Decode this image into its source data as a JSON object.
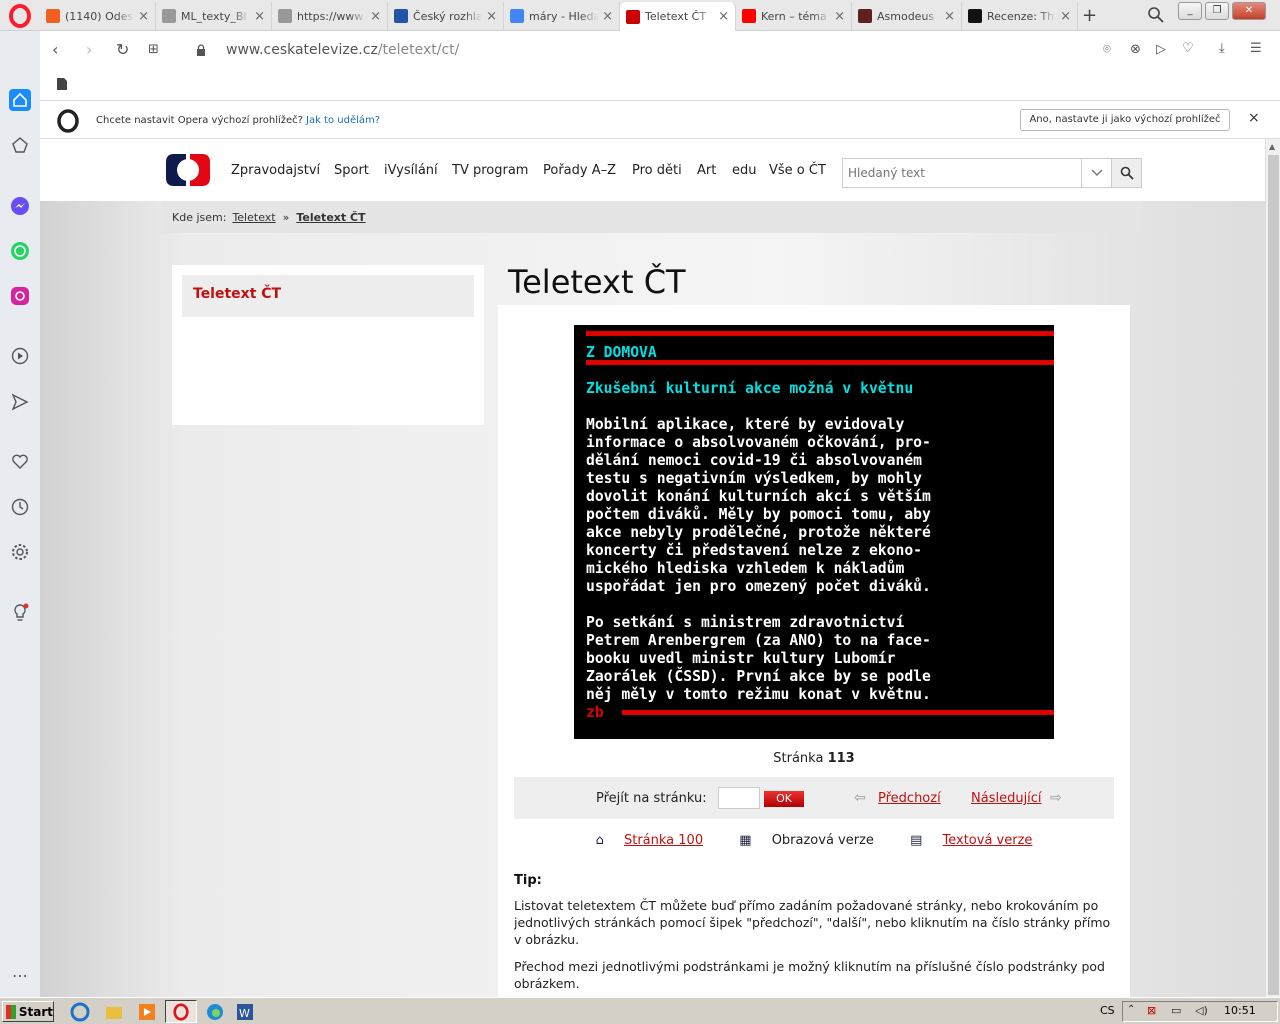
{
  "browser": {
    "tabs": [
      {
        "title": "(1140) Odes",
        "fav": "#f06020"
      },
      {
        "title": "ML_texty_Bl",
        "fav": "#999"
      },
      {
        "title": "https://www",
        "fav": "#999"
      },
      {
        "title": "Český rozhla",
        "fav": "#2255aa"
      },
      {
        "title": "máry - Hleda",
        "fav": "#4285f4"
      },
      {
        "title": "Teletext ČT",
        "fav": "#cc0000",
        "active": true
      },
      {
        "title": "Kern – téma",
        "fav": "#ff0000"
      },
      {
        "title": "Asmodeus -",
        "fav": "#602020"
      },
      {
        "title": "Recenze: Th",
        "fav": "#111"
      }
    ],
    "url_domain": "www.ceskatelevize.cz",
    "url_path": "/teletext/ct/"
  },
  "notification": {
    "text": "Chcete nastavit Opera výchozí prohlížeč?",
    "link": "Jak to udělám?",
    "button": "Ano, nastavte ji jako výchozí prohlížeč"
  },
  "site": {
    "nav": [
      "Zpravodajství",
      "Sport",
      "iVysílání",
      "TV program",
      "Pořady A–Z",
      "Pro děti",
      "Art",
      "edu",
      "Vše o ČT"
    ],
    "search_placeholder": "Hledaný text",
    "breadcrumb": {
      "label": "Kde jsem:",
      "items": [
        "Teletext",
        "Teletext ČT"
      ],
      "sep": "»"
    },
    "left_menu_item": "Teletext ČT",
    "title": "Teletext ČT"
  },
  "teletext": {
    "section": "Z DOMOVA",
    "headline": "Zkušební kulturní akce možná v květnu",
    "para1": [
      "Mobilní aplikace, které by evidovaly",
      "informace o absolvovaném očkování, pro-",
      "dělání nemoci covid-19 či absolvovaném",
      "testu s negativním výsledkem, by mohly",
      "dovolit konání kulturních akcí s větším",
      "počtem diváků. Měly by pomoci tomu, aby",
      "akce nebyly prodělečné, protože některé",
      "koncerty či představení nelze z ekono-",
      "mického hlediska vzhledem k nákladům",
      "uspořádat jen pro omezený počet diváků."
    ],
    "para2": [
      "Po setkání s ministrem zdravotnictví",
      "Petrem Arenbergrem (za ANO) to na face-",
      "booku uvedl ministr kultury Lubomír",
      "Zaorálek (ČSSD). První akce by se podle",
      "něj měly v tomto režimu konat v květnu."
    ],
    "signature": "zb"
  },
  "page_info": {
    "label": "Stránka",
    "number": "113"
  },
  "pager": {
    "goto_label": "Přejít na stránku:",
    "ok": "OK",
    "prev": "Předchozí",
    "next": "Následující"
  },
  "versions": {
    "home": "Stránka 100",
    "image": "Obrazová verze",
    "text": "Textová verze"
  },
  "tip": {
    "heading": "Tip:",
    "p1": "Listovat teletextem ČT můžete buď přímo zadáním požadované stránky, nebo krokováním po jednotlivých stránkách pomocí šipek \"předchozí\", \"další\", nebo kliknutím na číslo stránky přímo v obrázku.",
    "p2": "Přechod mezi jednotlivými podstránkami je možný kliknutím na příslušné číslo podstránky pod obrázkem."
  },
  "taskbar": {
    "start": "Start",
    "lang": "CS",
    "clock": "10:51"
  }
}
